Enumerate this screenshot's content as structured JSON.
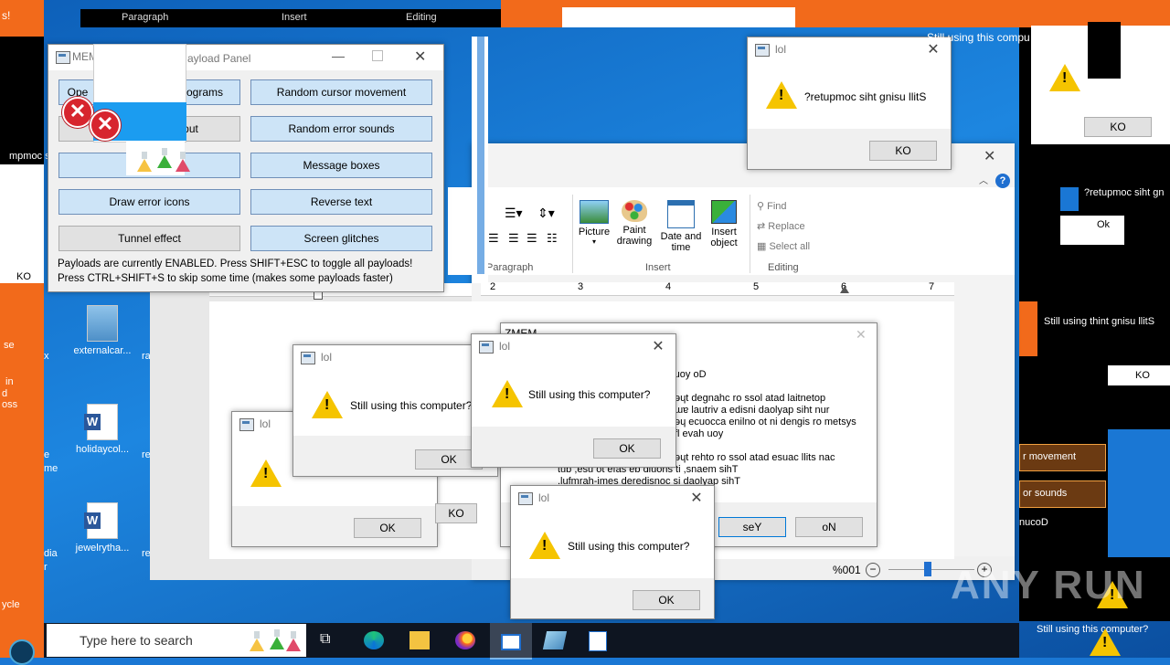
{
  "ribbon_top": {
    "paragraph": "Paragraph",
    "insert": "Insert",
    "editing": "Editing"
  },
  "payload_panel": {
    "title": "MEM",
    "title_tail": "ayload Panel",
    "buttons": [
      {
        "label": "Ope",
        "enabled": true
      },
      {
        "label": "rograms",
        "enabled": true
      },
      {
        "label": "Random cursor movement",
        "enabled": true
      },
      {
        "label": "put",
        "enabled": false
      },
      {
        "label": "Random error sounds",
        "enabled": true
      },
      {
        "label": "Message boxes",
        "enabled": true
      },
      {
        "label": "Draw error icons",
        "enabled": true
      },
      {
        "label": "Reverse text",
        "enabled": true
      },
      {
        "label": "Tunnel effect",
        "enabled": false
      },
      {
        "label": "Screen glitches",
        "enabled": true
      }
    ],
    "status1": "Payloads are currently ENABLED. Press SHIFT+ESC to toggle all payloads!",
    "status2": "Press CTRL+SHIFT+S to skip some time (makes some payloads faster)"
  },
  "dialog_title": "lol",
  "dialog_message": "Still using this computer?",
  "dialog_message_reversed": "?retupmoc siht gnisu llitS",
  "ok": "OK",
  "ok_reversed": "KO",
  "yes_reversed": "seY",
  "no_reversed": "oN",
  "wordpad": {
    "groups": {
      "paragraph": "Paragraph",
      "insert": "Insert",
      "editing": "Editing"
    },
    "insert_items": [
      "Picture",
      "Paint drawing",
      "Date and time",
      "Insert object"
    ],
    "paint_lines": [
      "Paint",
      "drawing"
    ],
    "date_lines": [
      "Date and",
      "time"
    ],
    "object_lines": [
      "Insert",
      "object"
    ],
    "editing_items": [
      "Find",
      "Replace",
      "Select all"
    ],
    "zoom": "%001",
    "ruler": [
      "2",
      "3",
      "4",
      "5",
      "6",
      "7"
    ]
  },
  "mem_dialog": {
    "title": "ZMEM",
    "lines": [
      "ɿuoy oD",
      "ǝɥt degnahc ro ssol atad laitnetop",
      "ɯɐ lautriv a edisni daolyap siht nur",
      "ǝɥ ecuocca enilno ot ni dengis ro metsys",
      "fl evah uoy",
      "ǝɥt rehto ro ssol atad esuac llits nac",
      "tub ,esu ot efas eb dluohs ti ,snaem sihT",
      ".lufmrah-imes deredisnoc si daolyap sihT"
    ],
    "yes": "seY",
    "no": "oN"
  },
  "right_panel": {
    "cursor": "r movement",
    "sounds": "or sounds",
    "doc": "nucoD",
    "mixed": "Still using thint gnisu llitS",
    "mirror": "?retupmoc siht gn",
    "ko": "KO",
    "ok_partial": "Ok",
    "tail_text": "Still using this compu"
  },
  "desktop_icons": [
    {
      "label": "externalcar..."
    },
    {
      "label": "holidaycol..."
    },
    {
      "label": "jewelrytha..."
    }
  ],
  "desk_fragments": {
    "ra": "ra",
    "re": "re",
    "x": "x",
    "me": "me",
    "e": "e",
    "dia": "dia",
    "r": "r",
    "cycle": "ycle",
    "se": "se",
    "in": "in",
    "d": "d",
    "oss": "oss",
    "mpmoc": "mpmoc s",
    "ko": "KO",
    "exclaim": "s!",
    "R": "R"
  },
  "taskbar": {
    "search_placeholder": "Type here to search"
  },
  "watermark": "ANY RUN"
}
